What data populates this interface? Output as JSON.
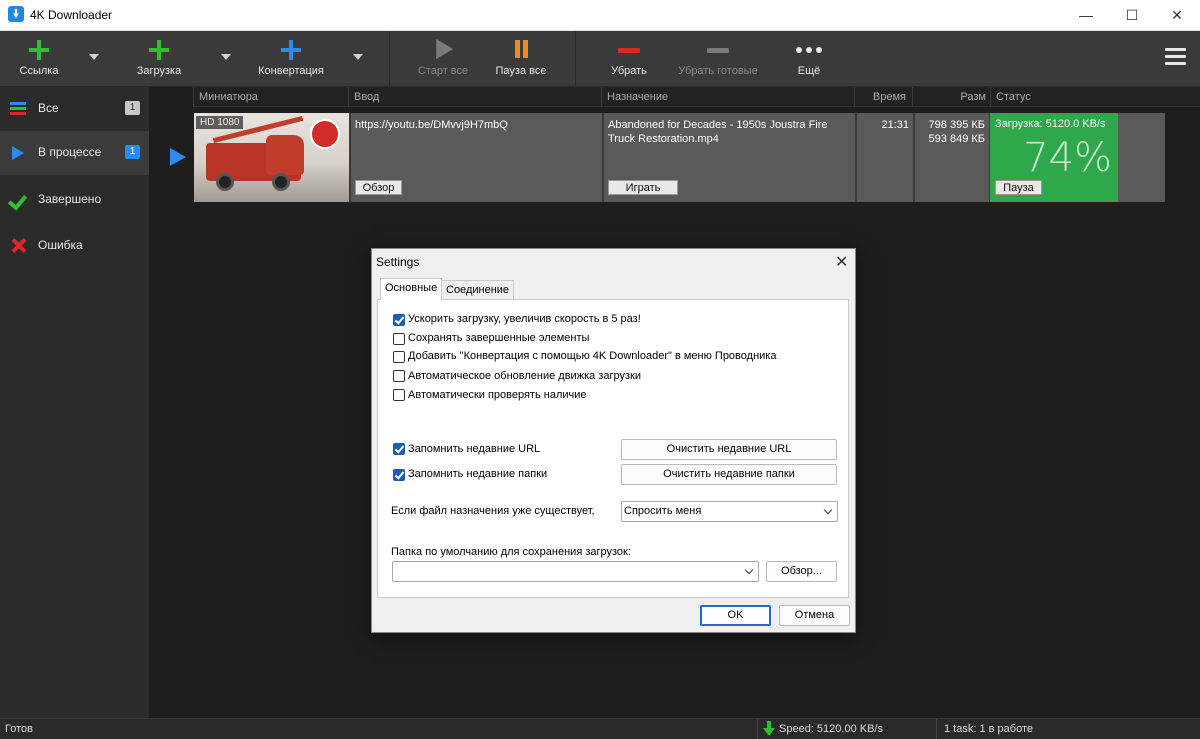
{
  "window": {
    "title": "4K Downloader",
    "minimize": "—",
    "maximize": "☐",
    "close": "✕"
  },
  "toolbar": {
    "link": "Ссылка",
    "download": "Загрузка",
    "convert": "Конвертация",
    "start_all": "Старт все",
    "pause_all": "Пауза все",
    "remove": "Убрать",
    "remove_done": "Убрать готовые",
    "more": "Ещё"
  },
  "sidebar": {
    "items": [
      {
        "label": "Все",
        "count": "1"
      },
      {
        "label": "В процессе",
        "count": "1"
      },
      {
        "label": "Завершено"
      },
      {
        "label": "Ошибка"
      }
    ]
  },
  "columns": {
    "thumbnail": "Миниатюра",
    "input": "Ввод",
    "destination": "Назначение",
    "time": "Время",
    "size": "Разм",
    "status": "Статус"
  },
  "download": {
    "quality": "HD 1080",
    "url": "https://youtu.be/DMvvj9H7mbQ",
    "browse": "Обзор",
    "filename": "Abandoned for Decades - 1950s Joustra Fire Truck Restoration.mp4",
    "play": "Играть",
    "time": "21:31",
    "size_total": "798 395 КБ",
    "size_done": "593 849 КБ",
    "status_text": "Загрузка: 5120.0 KB/s",
    "percent": "74%",
    "pause": "Пауза",
    "progress": 0.74
  },
  "statusbar": {
    "ready": "Готов",
    "speed": "Speed: 5120.00 KB/s",
    "tasks": "1 task: 1 в работе"
  },
  "settings": {
    "title": "Settings",
    "close": "✕",
    "tabs": [
      "Основные",
      "Соединение"
    ],
    "options": [
      {
        "label": "Ускорить загрузку, увеличив скорость в 5 раз!",
        "checked": true
      },
      {
        "label": "Сохранять завершенные элементы",
        "checked": false
      },
      {
        "label": "Добавить \"Конвертация с помощью 4K Downloader\" в меню Проводника",
        "checked": false
      },
      {
        "label": "Автоматическое обновление движка загрузки",
        "checked": false
      },
      {
        "label": "Автоматически проверять наличие",
        "checked": false
      }
    ],
    "remember_urls": "Запомнить недавние URL",
    "remember_folders": "Запомнить недавние папки",
    "clear_urls": "Очистить недавние URL",
    "clear_folders": "Очистить недавние папки",
    "if_exists_label": "Если файл назначения уже существует,",
    "if_exists_value": "Спросить меня",
    "default_folder_label": "Папка по умолчанию для сохранения загрузок:",
    "default_folder_value": "",
    "browse": "Обзор...",
    "ok": "OK",
    "cancel": "Отмена"
  }
}
